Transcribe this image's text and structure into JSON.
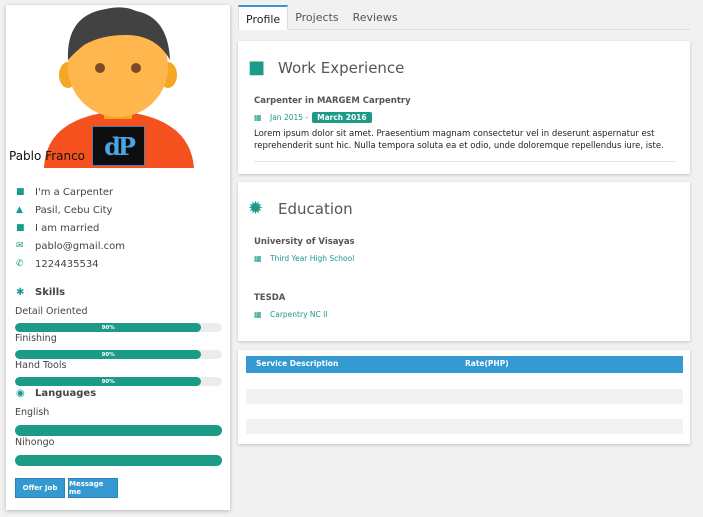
{
  "profile": {
    "name": "Pablo Franco",
    "logo_text": "dP",
    "info": [
      {
        "icon": "briefcase-icon",
        "text": "I'm a Carpenter"
      },
      {
        "icon": "home-icon",
        "text": "Pasil, Cebu City"
      },
      {
        "icon": "briefcase-icon",
        "text": "I am married"
      },
      {
        "icon": "envelope-icon",
        "text": "pablo@gmail.com"
      },
      {
        "icon": "phone-icon",
        "text": "1224435534"
      }
    ],
    "skills_title": "Skills",
    "skills": [
      {
        "label": "Detail Oriented",
        "percent": 90,
        "percent_label": "90%"
      },
      {
        "label": "Finishing",
        "percent": 90,
        "percent_label": "90%"
      },
      {
        "label": "Hand Tools",
        "percent": 90,
        "percent_label": "90%"
      }
    ],
    "languages_title": "Languages",
    "languages": [
      {
        "label": "English",
        "level": 100
      },
      {
        "label": "Nihongo",
        "level": 100
      }
    ],
    "buttons": {
      "offer": "Offer Job",
      "message": "Message me"
    }
  },
  "tabs": [
    {
      "label": "Profile",
      "active": true
    },
    {
      "label": "Projects",
      "active": false
    },
    {
      "label": "Reviews",
      "active": false
    }
  ],
  "work": {
    "title": "Work Experience",
    "job_title": "Carpenter in MARGEM Carpentry",
    "date_start": "Jan 2015 -",
    "date_end": "March 2016",
    "description": "Lorem ipsum dolor sit amet. Praesentium magnam consectetur vel in deserunt aspernatur est reprehenderit sunt hic. Nulla tempora soluta ea et odio, unde doloremque repellendus iure, iste."
  },
  "education": {
    "title": "Education",
    "items": [
      {
        "school": "University of Visayas",
        "detail": "Third Year High School"
      },
      {
        "school": "TESDA",
        "detail": "Carpentry NC II"
      }
    ]
  },
  "services": {
    "columns": [
      "Service Description",
      "Rate(PHP)"
    ]
  },
  "colors": {
    "accent": "#1a9a87",
    "primary": "#3498d1"
  }
}
